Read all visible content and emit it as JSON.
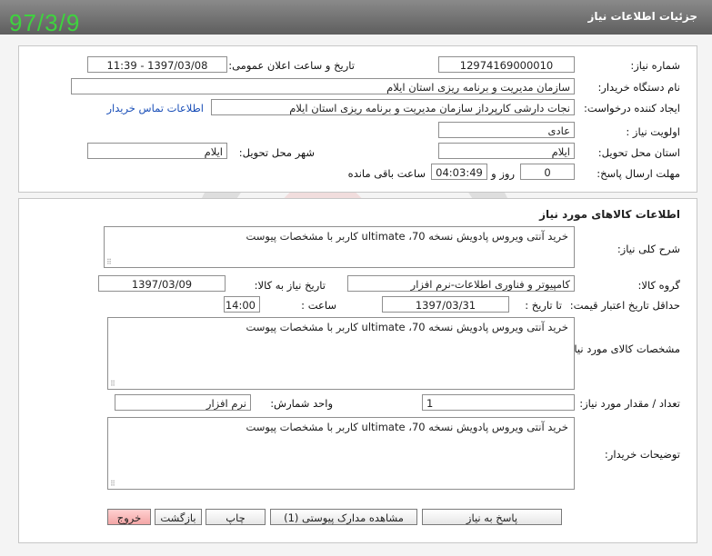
{
  "header": {
    "title": "جزئیات اطلاعات نیاز",
    "stamp": "97/3/9"
  },
  "need_info": {
    "need_number_label": "شماره نیاز:",
    "need_number": "12974169000010",
    "announce_label": "تاریخ و ساعت اعلان عمومی:",
    "announce_value": "1397/03/08 - 11:39",
    "buyer_org_label": "نام دستگاه خریدار:",
    "buyer_org": "سازمان مدیریت و برنامه ریزی استان ایلام",
    "creator_label": "ایجاد کننده درخواست:",
    "creator": "نجات دارشی کارپرداز سازمان مدیریت و برنامه ریزی استان ایلام",
    "contact_link": "اطلاعات تماس خریدار",
    "priority_label": "اولویت نیاز :",
    "priority": "عادی",
    "province_label": "استان محل تحویل:",
    "province": "ایلام",
    "city_label": "شهر محل تحویل:",
    "city": "ایلام",
    "deadline_label": "مهلت ارسال پاسخ:",
    "days_value": "0",
    "days_label": "روز و",
    "time_value": "04:03:49",
    "time_label": "ساعت باقی مانده"
  },
  "goods": {
    "section_title": "اطلاعات کالاهای مورد نیاز",
    "summary_label": "شرح کلی نیاز:",
    "summary": "خرید آنتی ویروس پادویش نسخه 70، ultimate کاربر  با مشخصات پیوست",
    "group_label": "گروه کالا:",
    "group": "کامپیوتر و فناوری اطلاعات-نرم افزار",
    "need_date_label": "تاریخ نیاز به کالا:",
    "need_date": "1397/03/09",
    "min_price_label": "حداقل تاریخ اعتبار قیمت:",
    "until_date_label": "تا تاریخ :",
    "until_date": "1397/03/31",
    "hour_label": "ساعت :",
    "hour": "14:00",
    "specs_label": "مشخصات کالای مورد نیاز:",
    "specs": "خرید آنتی ویروس پادویش نسخه 70، ultimate کاربر  با مشخصات پیوست",
    "qty_label": "تعداد / مقدار مورد نیاز:",
    "qty": "1",
    "unit_label": "واحد شمارش:",
    "unit": "نرم افزار",
    "buyer_notes_label": "توضیحات خریدار:",
    "buyer_notes": "خرید آنتی ویروس پادویش نسخه 70، ultimate کاربر  با مشخصات پیوست"
  },
  "buttons": {
    "reply": "پاسخ به نیاز",
    "attachments": "مشاهده مدارک پیوستی (1)",
    "print": "چاپ",
    "back": "بازگشت",
    "exit": "خروج"
  },
  "colors": {
    "header": "#6e6e6e",
    "stamp": "#3fd23f",
    "exit_button": "#f3a6a6",
    "watermark": "#e04a4a"
  }
}
